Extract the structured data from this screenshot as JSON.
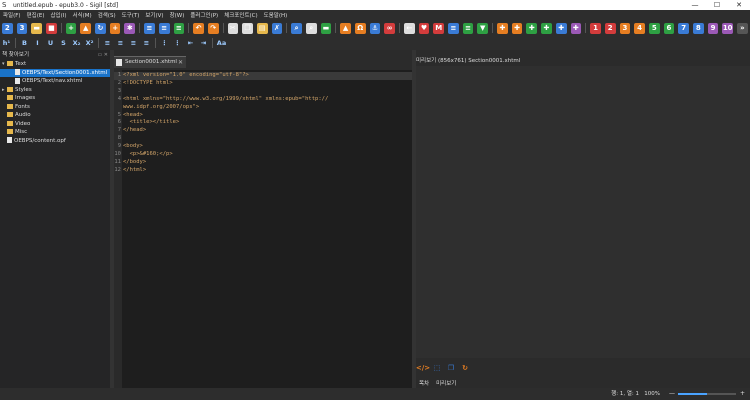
{
  "window": {
    "title": "untitled.epub - epub3.0 - Sigil [std]"
  },
  "menu": [
    "파일(F)",
    "편집(E)",
    "삽입(I)",
    "서식(M)",
    "검색(S)",
    "도구(T)",
    "보기(V)",
    "창(W)",
    "플러그인(P)",
    "체크포인트(C)",
    "도움말(H)"
  ],
  "toolbar1": {
    "icons": [
      {
        "name": "new-epub-icon",
        "glyph": "2",
        "color": "#3a7bd5"
      },
      {
        "name": "new-epub3-icon",
        "glyph": "3",
        "color": "#3a7bd5"
      },
      {
        "name": "open-folder-icon",
        "glyph": "▬",
        "color": "#e6b84c"
      },
      {
        "name": "save-icon",
        "glyph": "■",
        "color": "#d33c3c"
      },
      {
        "name": "add-file-icon",
        "glyph": "+",
        "color": "#2ea043"
      },
      {
        "name": "up-arrow-icon",
        "glyph": "▲",
        "color": "#e67e22"
      },
      {
        "name": "refresh-icon",
        "glyph": "↻",
        "color": "#3a7bd5"
      },
      {
        "name": "add-existing-icon",
        "glyph": "+",
        "color": "#e67e22"
      },
      {
        "name": "settings-icon",
        "glyph": "✱",
        "color": "#9b59b6"
      },
      {
        "name": "indent-icon",
        "glyph": "≡",
        "color": "#3a7bd5"
      },
      {
        "name": "outdent-icon",
        "glyph": "≡",
        "color": "#3a7bd5"
      },
      {
        "name": "format-icon",
        "glyph": "≡",
        "color": "#2ea043"
      },
      {
        "name": "undo-icon",
        "glyph": "↶",
        "color": "#e67e22"
      },
      {
        "name": "redo-icon",
        "glyph": "↷",
        "color": "#e67e22"
      },
      {
        "name": "cut-icon",
        "glyph": "✂",
        "color": "#dddddd"
      },
      {
        "name": "copy-icon",
        "glyph": "❐",
        "color": "#dddddd"
      },
      {
        "name": "paste-icon",
        "glyph": "▤",
        "color": "#e6b84c"
      },
      {
        "name": "clean-icon",
        "glyph": "✗",
        "color": "#3a7bd5"
      },
      {
        "name": "search-icon",
        "glyph": "⌕",
        "color": "#3a7bd5"
      },
      {
        "name": "zoom-icon",
        "glyph": "⌕",
        "color": "#dddddd"
      },
      {
        "name": "replace-icon",
        "glyph": "▬",
        "color": "#2ea043"
      },
      {
        "name": "image-icon",
        "glyph": "▲",
        "color": "#e67e22"
      },
      {
        "name": "omega-icon",
        "glyph": "Ω",
        "color": "#e67e22"
      },
      {
        "name": "anchor-icon",
        "glyph": "⚓",
        "color": "#3a7bd5"
      },
      {
        "name": "link-icon",
        "glyph": "∞",
        "color": "#d33c3c"
      },
      {
        "name": "back-arrow-icon",
        "glyph": "←",
        "color": "#dddddd"
      },
      {
        "name": "heart-icon",
        "glyph": "♥",
        "color": "#d33c3c"
      },
      {
        "name": "metadata-icon",
        "glyph": "M",
        "color": "#d33c3c"
      },
      {
        "name": "list-icon",
        "glyph": "≡",
        "color": "#3a7bd5"
      },
      {
        "name": "validate-icon",
        "glyph": "≡",
        "color": "#2ea043"
      },
      {
        "name": "download-icon",
        "glyph": "▼",
        "color": "#2ea043"
      },
      {
        "name": "puzzle-icon",
        "glyph": "✚",
        "color": "#e67e22"
      },
      {
        "name": "puzzle2-icon",
        "glyph": "✚",
        "color": "#e67e22"
      },
      {
        "name": "puzzle3-icon",
        "glyph": "✚",
        "color": "#2ea043"
      },
      {
        "name": "puzzle4-icon",
        "glyph": "✚",
        "color": "#2ea043"
      },
      {
        "name": "puzzle5-icon",
        "glyph": "✚",
        "color": "#3a7bd5"
      },
      {
        "name": "puzzle6-icon",
        "glyph": "✚",
        "color": "#9b59b6"
      },
      {
        "name": "plugin1-icon",
        "glyph": "1",
        "color": "#d33c3c"
      },
      {
        "name": "plugin2-icon",
        "glyph": "2",
        "color": "#d33c3c"
      },
      {
        "name": "plugin3-icon",
        "glyph": "3",
        "color": "#e67e22"
      },
      {
        "name": "plugin4-icon",
        "glyph": "4",
        "color": "#e67e22"
      },
      {
        "name": "plugin5-icon",
        "glyph": "5",
        "color": "#2ea043"
      },
      {
        "name": "plugin6-icon",
        "glyph": "6",
        "color": "#2ea043"
      },
      {
        "name": "plugin7-icon",
        "glyph": "7",
        "color": "#3a7bd5"
      },
      {
        "name": "plugin8-icon",
        "glyph": "8",
        "color": "#3a7bd5"
      },
      {
        "name": "plugin9-icon",
        "glyph": "9",
        "color": "#9b59b6"
      },
      {
        "name": "plugin10-icon",
        "glyph": "10",
        "color": "#9b59b6"
      },
      {
        "name": "more-icon",
        "glyph": "»",
        "color": "#555555"
      }
    ]
  },
  "toolbar2": {
    "icons": [
      {
        "name": "heading-icon",
        "glyph": "h¹"
      },
      {
        "name": "bold-icon",
        "glyph": "B"
      },
      {
        "name": "italic-icon",
        "glyph": "I"
      },
      {
        "name": "underline-icon",
        "glyph": "U"
      },
      {
        "name": "strikethrough-icon",
        "glyph": "S"
      },
      {
        "name": "subscript-icon",
        "glyph": "X₂"
      },
      {
        "name": "superscript-icon",
        "glyph": "X²"
      },
      {
        "name": "align-left-icon",
        "glyph": "≡"
      },
      {
        "name": "align-center-icon",
        "glyph": "≡"
      },
      {
        "name": "align-right-icon",
        "glyph": "≡"
      },
      {
        "name": "align-justify-icon",
        "glyph": "≡"
      },
      {
        "name": "numbered-list-icon",
        "glyph": "⋮"
      },
      {
        "name": "bullet-list-icon",
        "glyph": "⋮"
      },
      {
        "name": "decrease-indent-icon",
        "glyph": "⇤"
      },
      {
        "name": "increase-indent-icon",
        "glyph": "⇥"
      },
      {
        "name": "change-case-icon",
        "glyph": "Aa"
      }
    ]
  },
  "browser": {
    "title": "책 찾아보기",
    "items": [
      {
        "label": "Text",
        "kind": "folder",
        "indent": 0,
        "arrow": "▾"
      },
      {
        "label": "OEBPS/Text/Section0001.xhtml",
        "kind": "file",
        "indent": 1,
        "selected": true
      },
      {
        "label": "OEBPS/Text/nav.xhtml",
        "kind": "file",
        "indent": 1
      },
      {
        "label": "Styles",
        "kind": "folder",
        "indent": 0,
        "arrow": "▸"
      },
      {
        "label": "Images",
        "kind": "folder",
        "indent": 0
      },
      {
        "label": "Fonts",
        "kind": "folder",
        "indent": 0
      },
      {
        "label": "Audio",
        "kind": "folder",
        "indent": 0
      },
      {
        "label": "Video",
        "kind": "folder",
        "indent": 0
      },
      {
        "label": "Misc",
        "kind": "folder",
        "indent": 0
      },
      {
        "label": "OEBPS/content.opf",
        "kind": "file",
        "indent": 0
      }
    ]
  },
  "editor": {
    "tab_label": "Section0001.xhtml",
    "lines": [
      {
        "n": "1",
        "text": "<?xml version=\"1.0\" encoding=\"utf-8\"?>"
      },
      {
        "n": "2",
        "text": "<!DOCTYPE html>"
      },
      {
        "n": "3",
        "text": ""
      },
      {
        "n": "4",
        "text": "<html xmlns=\"http://www.w3.org/1999/xhtml\" xmlns:epub=\"http://"
      },
      {
        "n": "",
        "text": "www.idpf.org/2007/ops\">"
      },
      {
        "n": "5",
        "text": "<head>"
      },
      {
        "n": "6",
        "text": "  <title></title>"
      },
      {
        "n": "7",
        "text": "</head>"
      },
      {
        "n": "8",
        "text": ""
      },
      {
        "n": "9",
        "text": "<body>"
      },
      {
        "n": "10",
        "text": "  <p>&#160;</p>"
      },
      {
        "n": "11",
        "text": "</body>"
      },
      {
        "n": "12",
        "text": "</html>"
      }
    ]
  },
  "preview": {
    "title": "미리보기 (856x761) Section0001.xhtml",
    "tabs": [
      "목차",
      "미리보기"
    ]
  },
  "status": {
    "position": "행: 1, 열: 1",
    "zoom": "100%",
    "zoom_value": 0.5
  }
}
